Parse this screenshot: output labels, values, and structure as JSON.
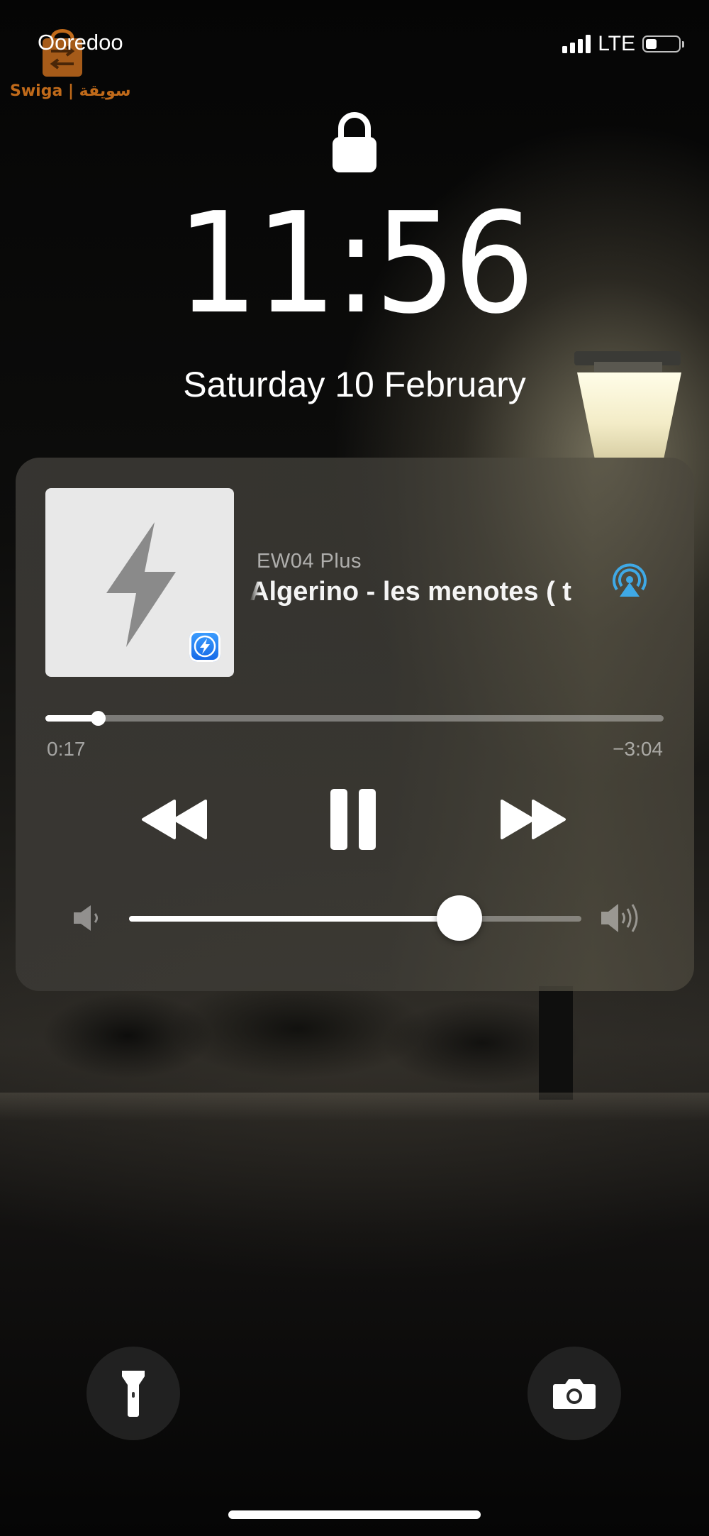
{
  "status_bar": {
    "carrier": "Ooredoo",
    "network": "LTE",
    "signal_bars": 4,
    "battery_level": 0.35
  },
  "watermark": {
    "text": "Swiga | سويقة"
  },
  "lock_screen": {
    "lock_icon": "lock-icon",
    "time": "11:56",
    "date": "Saturday 10 February"
  },
  "now_playing": {
    "device_name": "EW04 Plus",
    "track_title": "Algerino - les menotes ( t",
    "artwork_icon": "lightning-bolt-icon",
    "output_icon": "airplay-audio-icon",
    "elapsed": "0:17",
    "remaining": "−3:04",
    "progress": 0.085,
    "volume": 0.73,
    "controls": [
      "rewind",
      "pause",
      "fast-forward"
    ]
  },
  "quick_actions": [
    "flashlight",
    "camera"
  ],
  "colors": {
    "accent_airplay": "#3fa9e6",
    "app_badge": "#1a73e8",
    "watermark": "#c06a1a"
  }
}
